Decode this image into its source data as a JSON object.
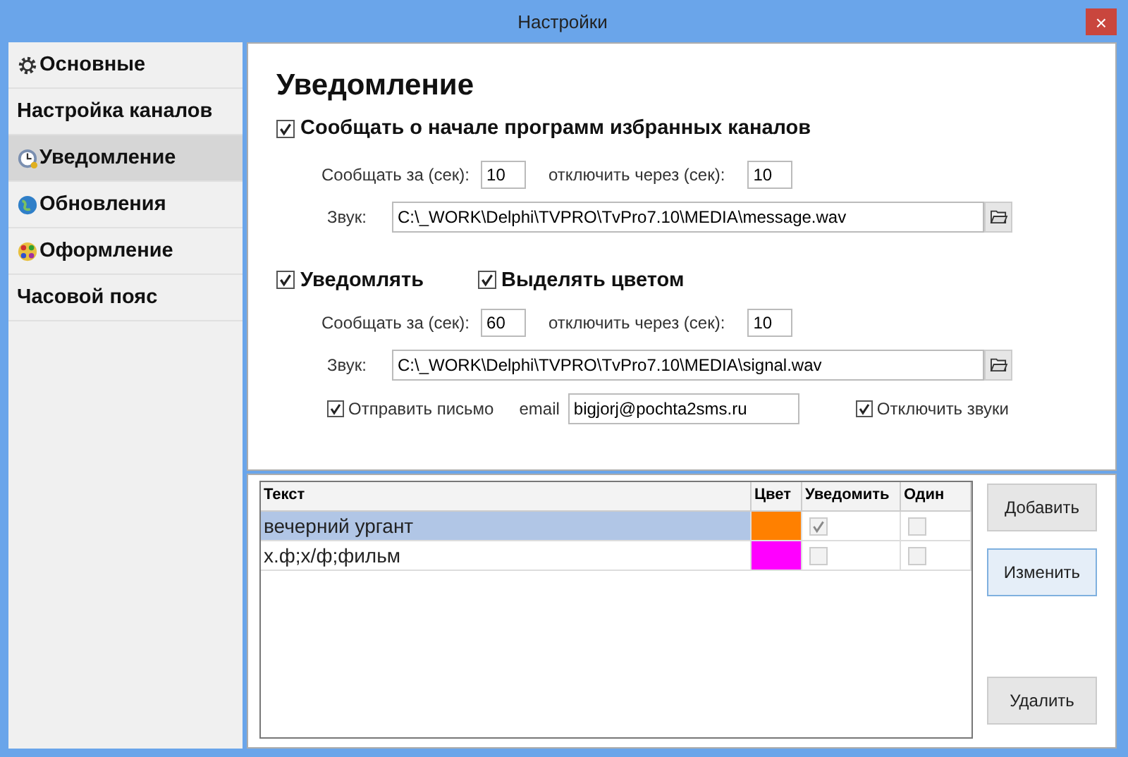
{
  "window": {
    "title": "Настройки",
    "close": "×"
  },
  "sidebar": {
    "items": [
      {
        "label": "Основные",
        "icon": true,
        "selected": false
      },
      {
        "label": "Настройка каналов",
        "icon": false,
        "selected": false
      },
      {
        "label": "Уведомление",
        "icon": true,
        "selected": true
      },
      {
        "label": "Обновления",
        "icon": true,
        "selected": false
      },
      {
        "label": "Оформление",
        "icon": true,
        "selected": false
      },
      {
        "label": "Часовой пояс",
        "icon": false,
        "selected": false
      }
    ]
  },
  "heading": "Уведомление",
  "favorites": {
    "checkbox": {
      "label": "Сообщать о начале программ избранных каналов",
      "checked": true
    },
    "before_label": "Сообщать за (сек):",
    "before_value": "10",
    "off_label": "отключить через (сек):",
    "off_value": "10",
    "sound_label": "Звук:",
    "sound_value": "C:\\_WORK\\Delphi\\TVPRO\\TvPro7.10\\MEDIA\\message.wav"
  },
  "notify": {
    "checkboxes": [
      {
        "label": "Уведомлять",
        "checked": true
      },
      {
        "label": "Выделять цветом",
        "checked": true
      }
    ],
    "before_label": "Сообщать за (сек):",
    "before_value": "60",
    "off_label": "отключить через (сек):",
    "off_value": "10",
    "sound_label": "Звук:",
    "sound_value": "C:\\_WORK\\Delphi\\TVPRO\\TvPro7.10\\MEDIA\\signal.wav",
    "send_mail": {
      "label": "Отправить письмо",
      "checked": true
    },
    "email_label": "email",
    "email_value": "bigjorj@pochta2sms.ru",
    "mute": {
      "label": "Отключить звуки",
      "checked": true
    }
  },
  "table": {
    "columns": [
      "Текст",
      "Цвет",
      "Уведомить",
      "Один"
    ],
    "rows": [
      {
        "text": "вечерний ургант",
        "color": "#ff8000",
        "notify": true,
        "single": false,
        "selected": true
      },
      {
        "text": "х.ф;х/ф;фильм",
        "color": "#ff00ff",
        "notify": false,
        "single": false,
        "selected": false
      }
    ]
  },
  "buttons": [
    {
      "label": "Добавить",
      "focused": false
    },
    {
      "label": "Изменить",
      "focused": true
    },
    {
      "label": "Удалить",
      "focused": false
    }
  ]
}
